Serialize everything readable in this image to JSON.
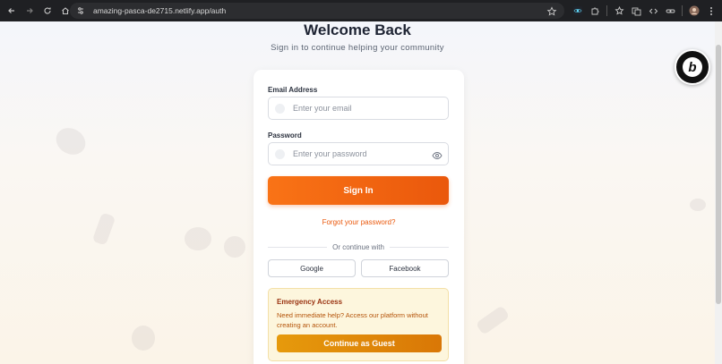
{
  "browser": {
    "url": "amazing-pasca-de2715.netlify.app/auth"
  },
  "page": {
    "title": "Welcome Back",
    "subtitle": "Sign in to continue helping your community"
  },
  "form": {
    "email_label": "Email Address",
    "email_placeholder": "Enter your email",
    "password_label": "Password",
    "password_placeholder": "Enter your password",
    "signin_label": "Sign In",
    "forgot_label": "Forgot your password?",
    "divider_text": "Or continue with",
    "google_label": "Google",
    "facebook_label": "Facebook"
  },
  "emergency": {
    "title": "Emergency Access",
    "text": "Need immediate help? Access our platform without creating an account.",
    "button_label": "Continue as Guest"
  },
  "badge": {
    "letter": "b"
  },
  "colors": {
    "accent": "#ea580c",
    "emergency_bg": "#fdf6dd",
    "guest_button": "#d97706"
  }
}
